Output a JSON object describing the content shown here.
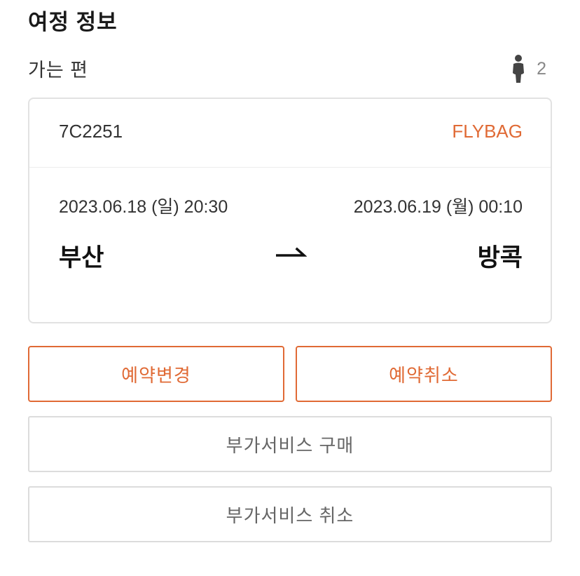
{
  "section": {
    "title": "여정 정보"
  },
  "leg": {
    "label": "가는 편",
    "passenger_icon": "person-icon",
    "passenger_count": "2"
  },
  "flight": {
    "number": "7C2251",
    "fare_type": "FLYBAG",
    "departure": {
      "datetime": "2023.06.18 (일) 20:30",
      "city": "부산"
    },
    "arrival": {
      "datetime": "2023.06.19 (월) 00:10",
      "city": "방콕"
    },
    "route_icon": "arrow-right-icon"
  },
  "actions": {
    "change_booking": "예약변경",
    "cancel_booking": "예약취소",
    "buy_addon": "부가서비스 구매",
    "cancel_addon": "부가서비스 취소"
  },
  "colors": {
    "accent": "#e06a35",
    "border": "#e2e2e2",
    "text_primary": "#1a1a1a",
    "text_muted": "#888888"
  }
}
